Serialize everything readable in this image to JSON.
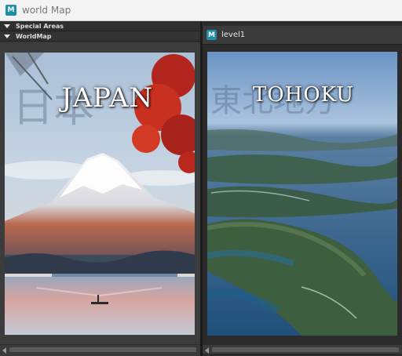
{
  "window": {
    "title": "world Map",
    "icon_letter": "M"
  },
  "left_panel": {
    "sections": [
      {
        "label": "Special Areas"
      },
      {
        "label": "WorldMap"
      }
    ],
    "image": {
      "title": "JAPAN",
      "kanji": "日本"
    }
  },
  "right_panel": {
    "tab_label": "level1",
    "icon_letter": "M",
    "image": {
      "title": "TOHOKU",
      "kanji": "東北地方"
    }
  }
}
